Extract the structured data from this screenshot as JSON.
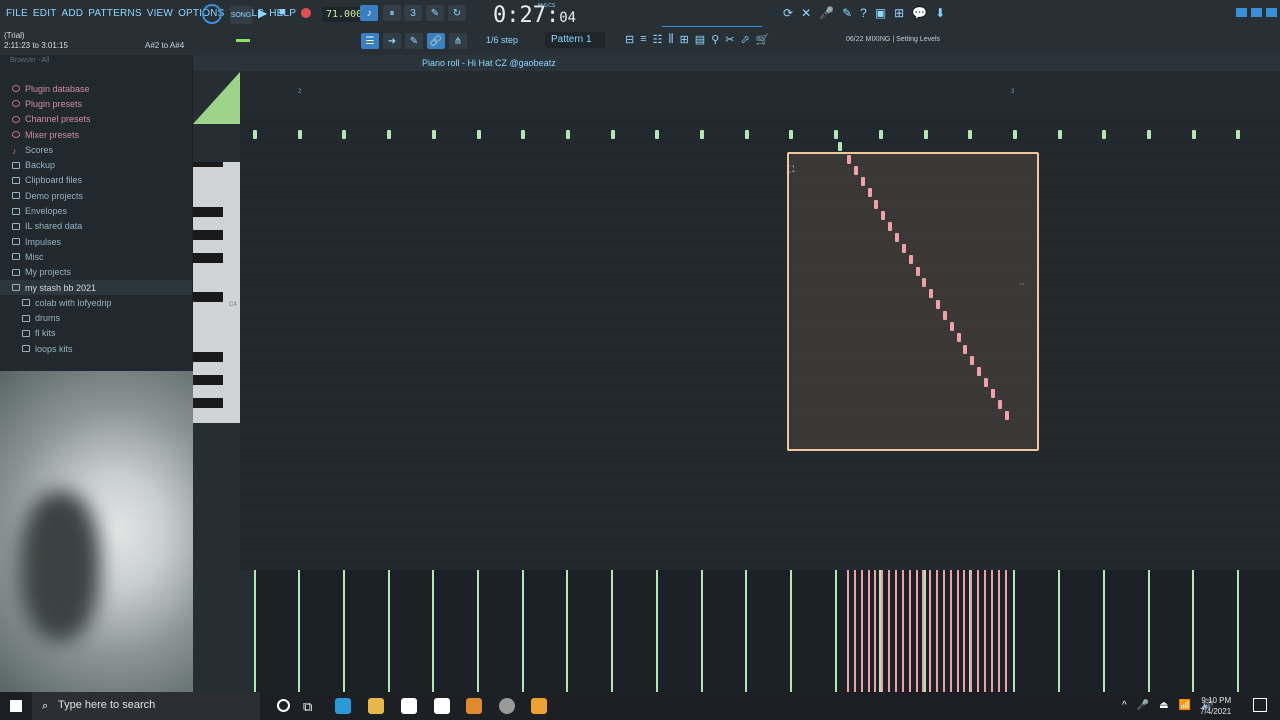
{
  "menu": [
    "FILE",
    "EDIT",
    "ADD",
    "PATTERNS",
    "VIEW",
    "OPTIONS",
    "TOOLS",
    "HELP"
  ],
  "transport": {
    "tempo": "71.000",
    "time_main": "0:27:",
    "time_sub": "04",
    "time_label": "M:S:CS"
  },
  "trial": {
    "status": "(Trial)",
    "range": "2:11:23 to 3:01:15"
  },
  "hint_keys": "A#2 to A#4",
  "snap": {
    "label": "1/6 step"
  },
  "pattern": {
    "label": "Pattern 1"
  },
  "hint_bar": {
    "counter": "06/22",
    "text": "MIXING | Setting Levels"
  },
  "browser": {
    "header": "Browser - All",
    "items": [
      {
        "label": "Plugin database",
        "type": "sys"
      },
      {
        "label": "Plugin presets",
        "type": "sys"
      },
      {
        "label": "Channel presets",
        "type": "sys"
      },
      {
        "label": "Mixer presets",
        "type": "sys"
      },
      {
        "label": "Scores",
        "type": "note"
      },
      {
        "label": "Backup",
        "type": "folder"
      },
      {
        "label": "Clipboard files",
        "type": "folder"
      },
      {
        "label": "Demo projects",
        "type": "folder"
      },
      {
        "label": "Envelopes",
        "type": "folder"
      },
      {
        "label": "IL shared data",
        "type": "folder"
      },
      {
        "label": "Impulses",
        "type": "folder"
      },
      {
        "label": "Misc",
        "type": "folder"
      },
      {
        "label": "My projects",
        "type": "folder"
      },
      {
        "label": "my stash bb 2021",
        "type": "folder-open"
      },
      {
        "label": "colab with lofyedrip",
        "type": "sub"
      },
      {
        "label": "drums",
        "type": "sub"
      },
      {
        "label": "fl kits",
        "type": "sub"
      },
      {
        "label": "loops kits",
        "type": "sub"
      }
    ]
  },
  "piano_roll": {
    "title": "Piano roll - Hi Hat CZ @gaobeatz",
    "bar_markers": [
      "2",
      "3"
    ],
    "key_label": "C4"
  },
  "taskbar": {
    "search_placeholder": "Type here to search",
    "time": "9:10 PM",
    "date": "7/4/2021"
  },
  "colors": {
    "accent": "#8fd6ff",
    "note_green": "#b4e6b4",
    "note_pink": "#f0a0a8",
    "selection": "#f0c89a"
  }
}
